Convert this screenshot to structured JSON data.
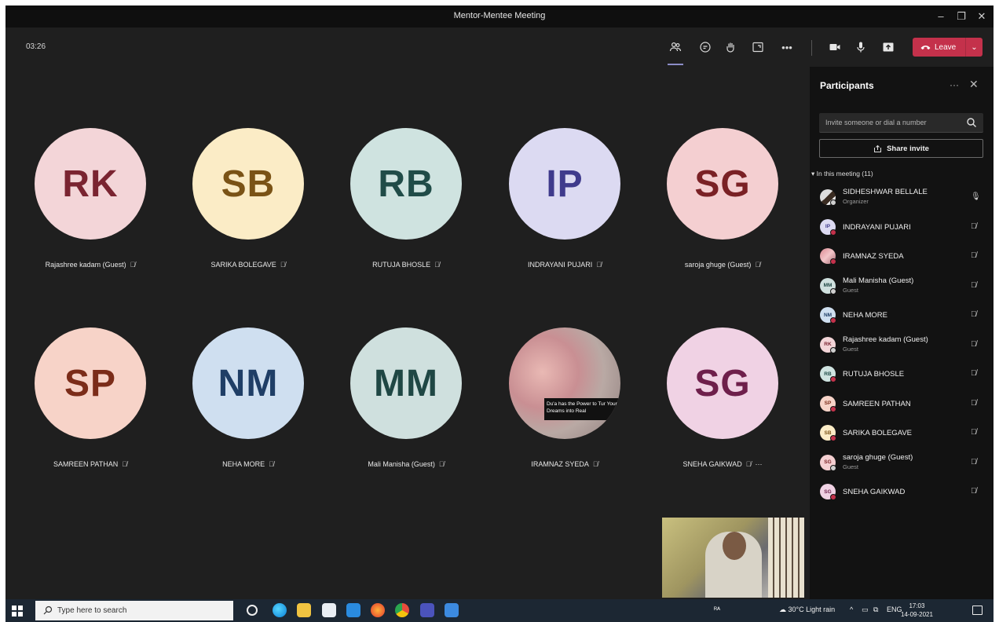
{
  "window": {
    "title": "Mentor-Mentee Meeting",
    "minimize": "–",
    "restore": "❐",
    "close": "✕"
  },
  "toolbar": {
    "timer": "03:26",
    "more": "•••",
    "leave_label": "Leave",
    "leave_chevron": "⌄",
    "colors": {
      "leave": "#c4314b",
      "active_underline": "#8b8cc7"
    }
  },
  "tiles": [
    {
      "initials": "RK",
      "name": "Rajashree kadam (Guest)",
      "bg": "#f3d5d8",
      "fg": "#7a2431"
    },
    {
      "initials": "SB",
      "name": "SARIKA BOLEGAVE",
      "bg": "#fbecc6",
      "fg": "#7a5316"
    },
    {
      "initials": "RB",
      "name": "RUTUJA BHOSLE",
      "bg": "#cfe3e0",
      "fg": "#204c48"
    },
    {
      "initials": "IP",
      "name": "INDRAYANI PUJARI",
      "bg": "#dcdaf2",
      "fg": "#3f3a8c"
    },
    {
      "initials": "SG",
      "name": "saroja ghuge (Guest)",
      "bg": "#f4cfd1",
      "fg": "#7a2125"
    },
    {
      "initials": "SP",
      "name": "SAMREEN PATHAN",
      "bg": "#f7d3c8",
      "fg": "#7b2c19"
    },
    {
      "initials": "NM",
      "name": "NEHA MORE",
      "bg": "#cfdff0",
      "fg": "#1f3e66"
    },
    {
      "initials": "MM",
      "name": "Mali Manisha (Guest)",
      "bg": "#cfe0de",
      "fg": "#1f4744"
    },
    {
      "initials": "",
      "name": "IRAMNAZ SYEDA",
      "video_caption": "Du'a has the Power to Tur Your Dreams into Real"
    },
    {
      "initials": "SG",
      "name": "SNEHA GAIKWAD",
      "bg": "#f0d2e4",
      "fg": "#6e1f4b",
      "more": "···"
    }
  ],
  "panel": {
    "title": "Participants",
    "more": "···",
    "close": "✕",
    "invite_placeholder": "Invite someone or dial a number",
    "share_label": "Share invite",
    "section": "In this meeting (11)",
    "participants": [
      {
        "initials": "",
        "name": "SIDHESHWAR BELLALE",
        "role": "Organizer",
        "photo": true,
        "mic": "on"
      },
      {
        "initials": "IP",
        "name": "INDRAYANI PUJARI",
        "role": "",
        "bg": "#dcdaf2",
        "fg": "#3f3a8c"
      },
      {
        "initials": "",
        "name": "IRAMNAZ SYEDA",
        "role": "",
        "photo": true
      },
      {
        "initials": "MM",
        "name": "Mali Manisha (Guest)",
        "role": "Guest",
        "bg": "#cfe0de",
        "fg": "#1f4744"
      },
      {
        "initials": "NM",
        "name": "NEHA MORE",
        "role": "",
        "bg": "#cfdff0",
        "fg": "#1f3e66"
      },
      {
        "initials": "RK",
        "name": "Rajashree kadam (Guest)",
        "role": "Guest",
        "bg": "#f3d5d8",
        "fg": "#7a2431"
      },
      {
        "initials": "RB",
        "name": "RUTUJA BHOSLE",
        "role": "",
        "bg": "#cfe3e0",
        "fg": "#204c48"
      },
      {
        "initials": "SP",
        "name": "SAMREEN PATHAN",
        "role": "",
        "bg": "#f7d3c8",
        "fg": "#7b2c19"
      },
      {
        "initials": "SB",
        "name": "SARIKA BOLEGAVE",
        "role": "",
        "bg": "#fbecc6",
        "fg": "#7a5316"
      },
      {
        "initials": "SG",
        "name": "saroja ghuge (Guest)",
        "role": "Guest",
        "bg": "#f4cfd1",
        "fg": "#7a2125"
      },
      {
        "initials": "SG",
        "name": "SNEHA GAIKWAD",
        "role": "",
        "bg": "#f0d2e4",
        "fg": "#6e1f4b"
      }
    ]
  },
  "taskbar": {
    "search_placeholder": "Type here to search",
    "weather": "30°C Light rain",
    "lang": "ENG",
    "time": "17:03",
    "date": "14-09-2021"
  }
}
